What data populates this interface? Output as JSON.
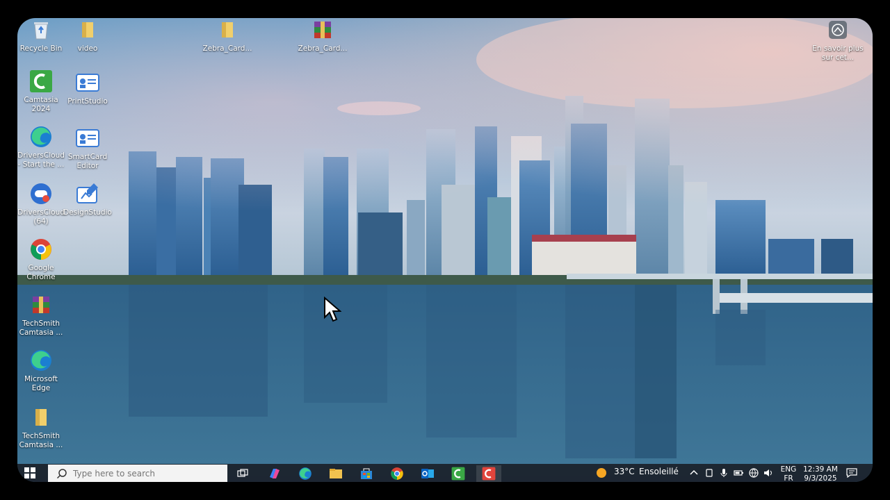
{
  "desktop": {
    "icons": [
      {
        "label": "Recycle Bin",
        "icon": "recycle-bin-icon"
      },
      {
        "label": "video",
        "icon": "folder-icon"
      },
      {
        "label": "Zebra_Card...",
        "icon": "folder-icon"
      },
      {
        "label": "Zebra_Card...",
        "icon": "winrar-archive-icon"
      },
      {
        "label": "Camtasia 2024",
        "icon": "camtasia-icon"
      },
      {
        "label": "PrintStudio",
        "icon": "card-printer-icon"
      },
      {
        "label": "DriversCloud - Start the ...",
        "icon": "edge-icon"
      },
      {
        "label": "SmartCard Editor",
        "icon": "card-printer-icon"
      },
      {
        "label": "DriversCloud (64)",
        "icon": "driverscloud-icon"
      },
      {
        "label": "DesignStudio",
        "icon": "design-studio-icon"
      },
      {
        "label": "Google Chrome",
        "icon": "chrome-icon"
      },
      {
        "label": "TechSmith Camtasia ...",
        "icon": "winrar-archive-icon"
      },
      {
        "label": "Microsoft Edge",
        "icon": "edge-icon"
      },
      {
        "label": "TechSmith Camtasia ...",
        "icon": "folder-icon"
      }
    ],
    "learn_more": {
      "label": "En savoir plus sur cet...",
      "icon": "camera-info-icon"
    }
  },
  "taskbar": {
    "search_placeholder": "Type here to search",
    "apps": [
      "task-view-icon",
      "copilot-icon",
      "edge-icon",
      "file-explorer-icon",
      "store-icon",
      "chrome-icon",
      "outlook-icon",
      "camtasia-icon",
      "camtasia-recorder-icon"
    ],
    "weather": {
      "temp": "33°C",
      "condition": "Ensoleillé",
      "icon": "sun-icon"
    },
    "tray_icons": [
      "chevron-up-icon",
      "network-drive-icon",
      "microphone-icon",
      "battery-icon",
      "globe-icon",
      "volume-icon"
    ],
    "language": {
      "code": "ENG",
      "region": "FR"
    },
    "clock": {
      "time": "12:39 AM",
      "date": "9/3/2025"
    },
    "notification_icon": "notification-icon"
  },
  "colors": {
    "taskbar": "#1c222c",
    "water": "#3f7697",
    "sky": "#9fb9d3"
  }
}
